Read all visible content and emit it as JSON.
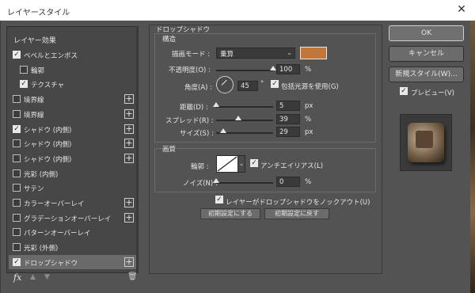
{
  "window": {
    "title": "レイヤースタイル",
    "close": "✕"
  },
  "left_panel": {
    "header": "レイヤー効果",
    "items": [
      {
        "label": "ベベルとエンボス",
        "checked": true,
        "plus": false,
        "indent": false
      },
      {
        "label": "輪郭",
        "checked": false,
        "plus": false,
        "indent": true
      },
      {
        "label": "テクスチャ",
        "checked": true,
        "plus": false,
        "indent": true
      },
      {
        "label": "境界線",
        "checked": false,
        "plus": true,
        "indent": false
      },
      {
        "label": "境界線",
        "checked": false,
        "plus": true,
        "indent": false
      },
      {
        "label": "シャドウ (内側)",
        "checked": true,
        "plus": true,
        "indent": false
      },
      {
        "label": "シャドウ (内側)",
        "checked": false,
        "plus": true,
        "indent": false
      },
      {
        "label": "シャドウ (内側)",
        "checked": false,
        "plus": true,
        "indent": false
      },
      {
        "label": "光彩 (内側)",
        "checked": false,
        "plus": false,
        "indent": false
      },
      {
        "label": "サテン",
        "checked": false,
        "plus": false,
        "indent": false
      },
      {
        "label": "カラーオーバーレイ",
        "checked": false,
        "plus": true,
        "indent": false
      },
      {
        "label": "グラデーションオーバーレイ",
        "checked": false,
        "plus": true,
        "indent": false
      },
      {
        "label": "パターンオーバーレイ",
        "checked": false,
        "plus": false,
        "indent": false
      },
      {
        "label": "光彩 (外側)",
        "checked": false,
        "plus": false,
        "indent": false
      },
      {
        "label": "ドロップシャドウ",
        "checked": true,
        "plus": true,
        "indent": false,
        "active": true
      }
    ],
    "footer": {
      "fx": "fx",
      "trash_icon": "🗑"
    }
  },
  "drop_shadow": {
    "title": "ドロップシャドウ",
    "structure": {
      "title": "構造",
      "blend_mode_label": "描画モード :",
      "blend_mode_value": "乗算",
      "shadow_color": "#c2773a",
      "opacity_label": "不透明度(O) :",
      "opacity_value": "100",
      "opacity_fraction": 1.0,
      "opacity_unit": "%",
      "angle_label": "角度(A) :",
      "angle_value": "45",
      "angle_unit": "°",
      "global_light_label": "包括光源を使用(G)",
      "global_light_checked": true,
      "distance_label": "距離(D) :",
      "distance_value": "5",
      "distance_fraction": 0.0,
      "distance_unit": "px",
      "spread_label": "スプレッド(R) :",
      "spread_value": "39",
      "spread_fraction": 0.39,
      "spread_unit": "%",
      "size_label": "サイズ(S) :",
      "size_value": "29",
      "size_fraction": 0.12,
      "size_unit": "px"
    },
    "quality": {
      "title": "画質",
      "contour_label": "輪郭 :",
      "antialias_label": "アンチエイリアス(L)",
      "antialias_checked": true,
      "noise_label": "ノイズ(N) :",
      "noise_value": "0",
      "noise_fraction": 0.0,
      "noise_unit": "%"
    },
    "knockout_label": "レイヤーがドロップシャドウをノックアウト(U)",
    "knockout_checked": true,
    "make_default": "初期設定にする",
    "reset_default": "初期設定に戻す"
  },
  "buttons": {
    "ok": "OK",
    "cancel": "キャンセル",
    "new_style": "新規スタイル(W)...",
    "preview_label": "プレビュー(V)",
    "preview_checked": true
  }
}
